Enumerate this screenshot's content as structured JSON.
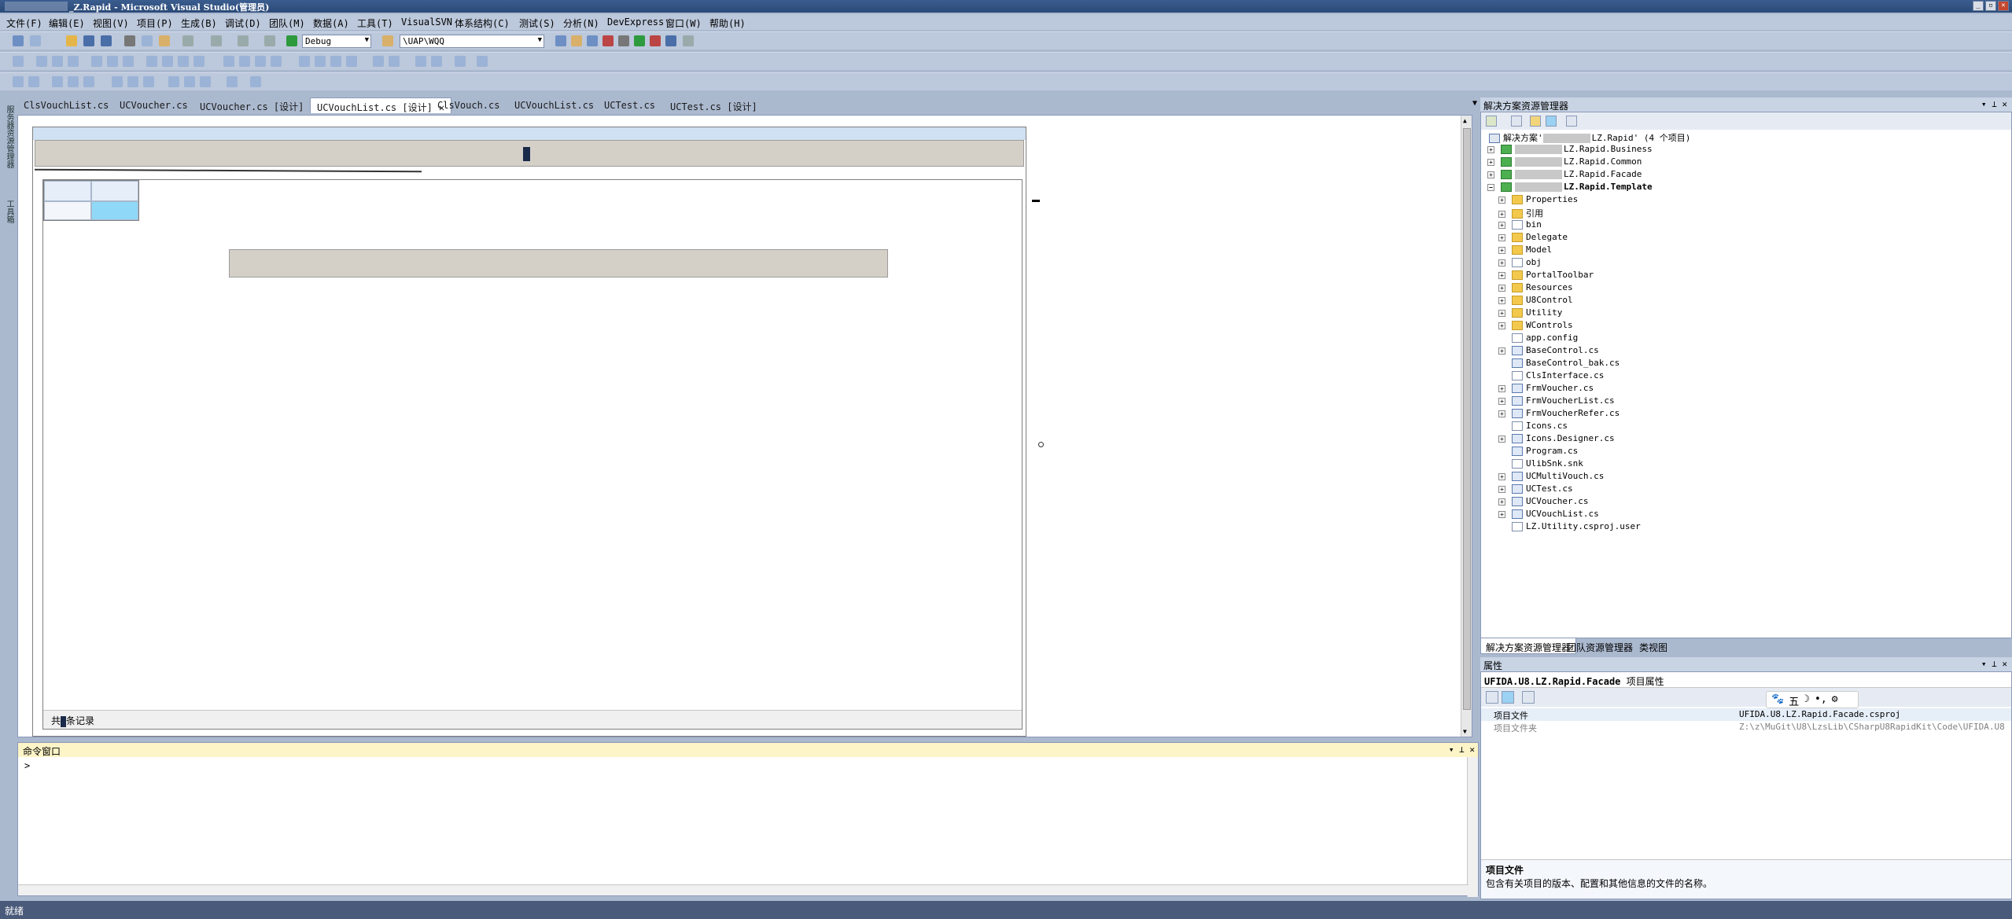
{
  "window": {
    "title": "_Z.Rapid - Microsoft Visual Studio(管理员)",
    "buttons": [
      "_",
      "▫",
      "✕"
    ]
  },
  "menu": [
    "文件(F)",
    "编辑(E)",
    "视图(V)",
    "项目(P)",
    "生成(B)",
    "调试(D)",
    "团队(M)",
    "数据(A)",
    "工具(T)",
    "VisualSVN",
    "体系结构(C)",
    "测试(S)",
    "分析(N)",
    "DevExpress",
    "窗口(W)",
    "帮助(H)"
  ],
  "toolbar": {
    "config": "Debug",
    "path": "\\UAP\\WQQ"
  },
  "left_strip": {
    "labels": [
      "服务器资源管理器",
      "工具箱"
    ]
  },
  "tabs": [
    {
      "label": "ClsVouchList.cs"
    },
    {
      "label": "UCVoucher.cs"
    },
    {
      "label": "UCVoucher.cs [设计]"
    },
    {
      "label": "UCVouchList.cs [设计]",
      "active": true
    },
    {
      "label": "ClsVouch.cs"
    },
    {
      "label": "UCVouchList.cs"
    },
    {
      "label": "UCTest.cs"
    },
    {
      "label": "UCTest.cs [设计]"
    }
  ],
  "designer": {
    "footer_prefix": "共",
    "footer_suffix": "条记录"
  },
  "command_window": {
    "title": "命令窗口",
    "prompt": ">"
  },
  "solution_explorer": {
    "title": "解决方案资源管理器",
    "solution_label": "解决方案'",
    "solution_tail": "LZ.Rapid' (4 个项目)",
    "projects": [
      "LZ.Rapid.Business",
      "LZ.Rapid.Common",
      "LZ.Rapid.Facade",
      "LZ.Rapid.Template"
    ],
    "items": [
      {
        "label": "Properties",
        "type": "folder",
        "exp": true
      },
      {
        "label": "引用",
        "type": "folder",
        "exp": true
      },
      {
        "label": "bin",
        "type": "file",
        "exp": true
      },
      {
        "label": "Delegate",
        "type": "folder",
        "exp": true
      },
      {
        "label": "Model",
        "type": "folder",
        "exp": true
      },
      {
        "label": "obj",
        "type": "file",
        "exp": true
      },
      {
        "label": "PortalToolbar",
        "type": "folder",
        "exp": true
      },
      {
        "label": "Resources",
        "type": "folder",
        "exp": true
      },
      {
        "label": "U8Control",
        "type": "folder",
        "exp": true
      },
      {
        "label": "Utility",
        "type": "folder",
        "exp": true
      },
      {
        "label": "WControls",
        "type": "folder",
        "exp": true
      },
      {
        "label": "app.config",
        "type": "file",
        "exp": false
      },
      {
        "label": "BaseControl.cs",
        "type": "cs",
        "exp": true
      },
      {
        "label": "BaseControl_bak.cs",
        "type": "cs",
        "exp": false
      },
      {
        "label": "ClsInterface.cs",
        "type": "file",
        "exp": false
      },
      {
        "label": "FrmVoucher.cs",
        "type": "cs",
        "exp": true
      },
      {
        "label": "FrmVoucherList.cs",
        "type": "cs",
        "exp": true
      },
      {
        "label": "FrmVoucherRefer.cs",
        "type": "cs",
        "exp": true
      },
      {
        "label": "Icons.cs",
        "type": "file",
        "exp": false
      },
      {
        "label": "Icons.Designer.cs",
        "type": "cs",
        "exp": true
      },
      {
        "label": "Program.cs",
        "type": "cs",
        "exp": false
      },
      {
        "label": "UlibSnk.snk",
        "type": "file",
        "exp": false
      },
      {
        "label": "UCMultiVouch.cs",
        "type": "cs",
        "exp": true
      },
      {
        "label": "UCTest.cs",
        "type": "cs",
        "exp": true
      },
      {
        "label": "UCVoucher.cs",
        "type": "cs",
        "exp": true
      },
      {
        "label": "UCVouchList.cs",
        "type": "cs",
        "exp": true
      },
      {
        "label": "LZ.Utility.csproj.user",
        "type": "file",
        "exp": false
      }
    ],
    "tabs": [
      "解决方案资源管理器",
      "团队资源管理器",
      "类视图"
    ]
  },
  "properties": {
    "title": "属性",
    "object": "UFIDA.U8.LZ.Rapid.Facade",
    "object_suffix": "项目属性",
    "ime": [
      "🐾",
      "五",
      "☽",
      "•,",
      "⚙"
    ],
    "rows": [
      {
        "key": "项目文件",
        "value": "UFIDA.U8.LZ.Rapid.Facade.csproj"
      },
      {
        "key": "项目文件夹",
        "value": "Z:\\z\\MuGit\\U8\\LzsLib\\CSharpU8RapidKit\\Code\\UFIDA.U8.LZ.Rapid.Facade"
      }
    ],
    "desc_title": "项目文件",
    "desc_text": "包含有关项目的版本、配置和其他信息的文件的名称。"
  },
  "statusbar": {
    "text": "就绪"
  },
  "colors": {
    "titlebar": "#2b4a78",
    "chrome": "#abb9cf",
    "cmd_header": "#fdf4c7",
    "grid_selected": "#8fd8f8"
  }
}
